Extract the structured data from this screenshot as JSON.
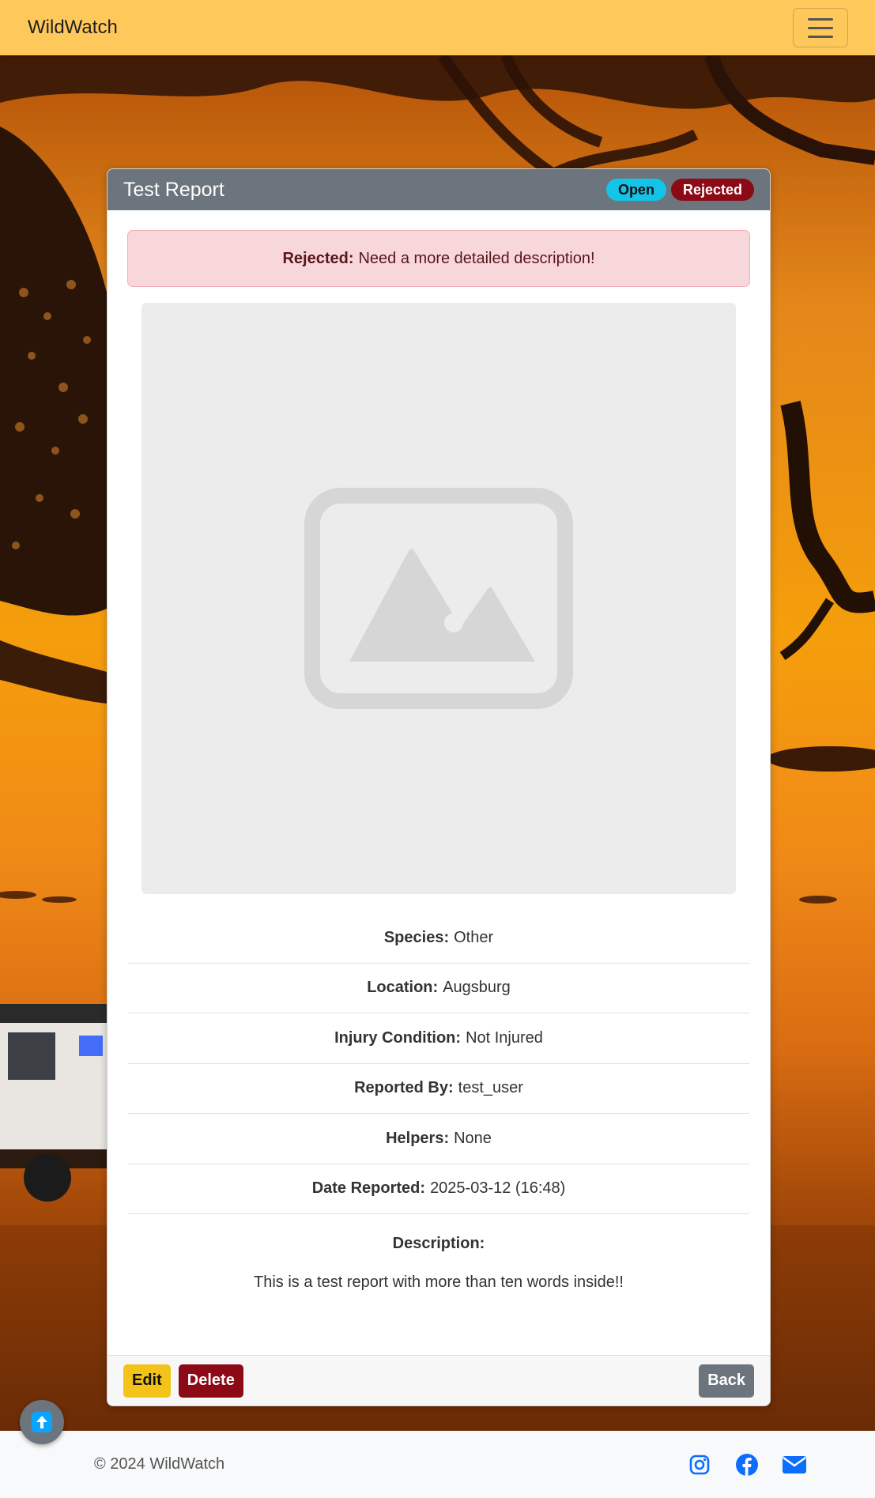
{
  "navbar": {
    "brand": "WildWatch",
    "menu_icon": "hamburger-menu-icon"
  },
  "report": {
    "title": "Test Report",
    "badges": {
      "status": "Open",
      "review": "Rejected"
    },
    "alert": {
      "label": "Rejected:",
      "message": "Need a more detailed description!"
    },
    "image_icon": "image-placeholder-icon",
    "details": [
      {
        "label": "Species:",
        "value": "Other"
      },
      {
        "label": "Location:",
        "value": "Augsburg"
      },
      {
        "label": "Injury Condition:",
        "value": "Not Injured"
      },
      {
        "label": "Reported By:",
        "value": "test_user"
      },
      {
        "label": "Helpers:",
        "value": "None"
      },
      {
        "label": "Date Reported:",
        "value": "2025-03-12 (16:48)"
      }
    ],
    "description_label": "Description:",
    "description": "This is a test report with more than ten words inside!!",
    "buttons": {
      "edit": "Edit",
      "delete": "Delete",
      "back": "Back"
    }
  },
  "scroll_top_icon": "arrow-up-icon",
  "footer": {
    "copyright": "© 2024 WildWatch",
    "social_icons": [
      "instagram-icon",
      "facebook-icon",
      "envelope-icon"
    ]
  },
  "colors": {
    "navbar": "#ffc85a",
    "header": "#6c757d",
    "badge_open": "#14c4e6",
    "badge_rejected": "#8b0a15",
    "edit": "#f3c319",
    "delete": "#8b0a15",
    "link_icons": "#0d6efd"
  }
}
